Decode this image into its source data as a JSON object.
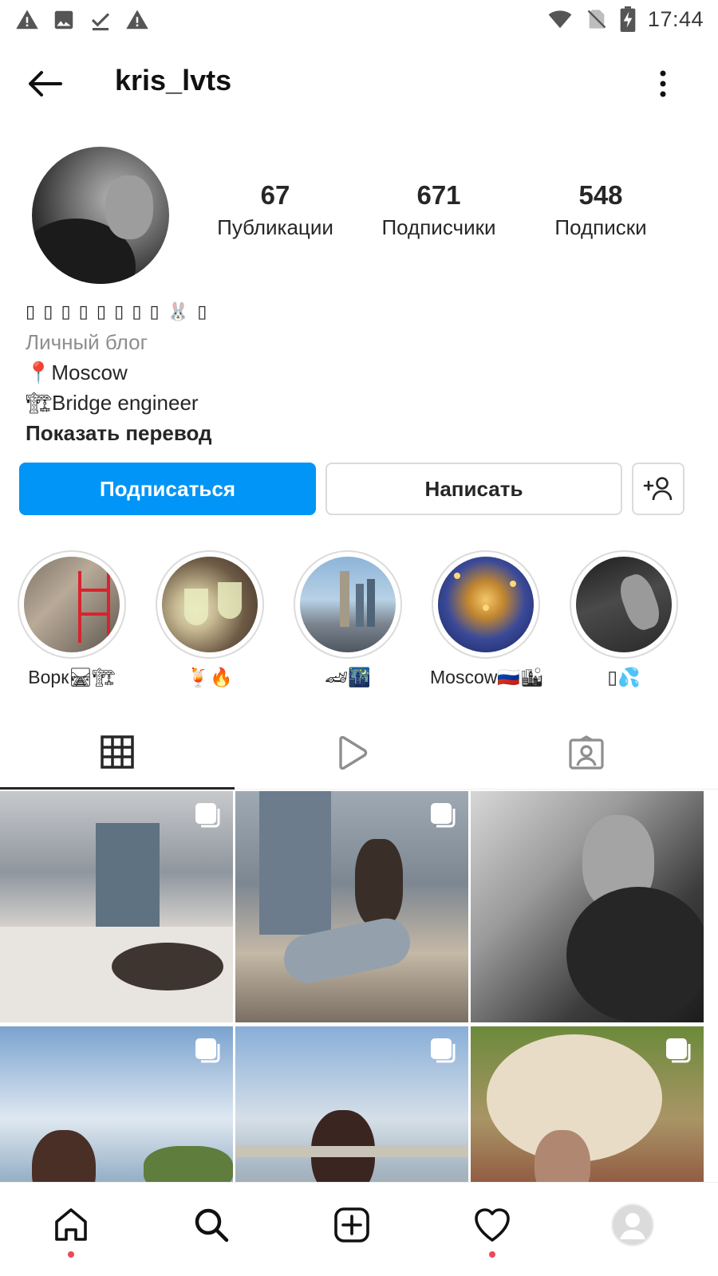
{
  "status_bar": {
    "time": "17:44",
    "left_icons": [
      "warning-icon",
      "image-icon",
      "download-done-icon",
      "warning-icon"
    ],
    "right_icons": [
      "wifi-icon",
      "no-sim-icon",
      "battery-charging-icon"
    ]
  },
  "header": {
    "username": "kris_lvts",
    "back_icon": "arrow-left-icon",
    "menu_icon": "more-vertical-icon"
  },
  "profile": {
    "stats": {
      "posts": {
        "value": "67",
        "label": "Публикации"
      },
      "followers": {
        "value": "671",
        "label": "Подписчики"
      },
      "following": {
        "value": "548",
        "label": "Подписки"
      }
    },
    "bio": {
      "name": "▯ ▯ ▯ ▯ ▯ ▯ ▯ ▯ 🐰 ▯",
      "category": "Личный блог",
      "location": "📍Moscow",
      "occupation": "🏗Bridge engineer",
      "translate_link": "Показать перевод"
    }
  },
  "actions": {
    "follow": "Подписаться",
    "message": "Написать",
    "suggest_icon": "add-person-icon"
  },
  "highlights": [
    {
      "label": "Ворк🛤🏗"
    },
    {
      "label": "🍹🔥"
    },
    {
      "label": "🏎🌃"
    },
    {
      "label": "Moscow🇷🇺🏙"
    },
    {
      "label": "▯💦"
    }
  ],
  "tabs": [
    {
      "name": "grid",
      "icon": "grid-icon",
      "active": true
    },
    {
      "name": "reels",
      "icon": "play-icon",
      "active": false
    },
    {
      "name": "tagged",
      "icon": "tagged-person-icon",
      "active": false
    }
  ],
  "bottom_nav": [
    {
      "name": "home",
      "icon": "home-icon",
      "notification_dot": true
    },
    {
      "name": "search",
      "icon": "search-icon",
      "notification_dot": false
    },
    {
      "name": "create",
      "icon": "add-square-icon",
      "notification_dot": false
    },
    {
      "name": "activity",
      "icon": "heart-icon",
      "notification_dot": true
    },
    {
      "name": "profile",
      "icon": "avatar-icon",
      "notification_dot": false
    }
  ],
  "colors": {
    "primary_button": "#0095f6",
    "notification_dot": "#ed4956",
    "secondary_text": "#8e8e8e",
    "border": "#dbdbdb"
  }
}
